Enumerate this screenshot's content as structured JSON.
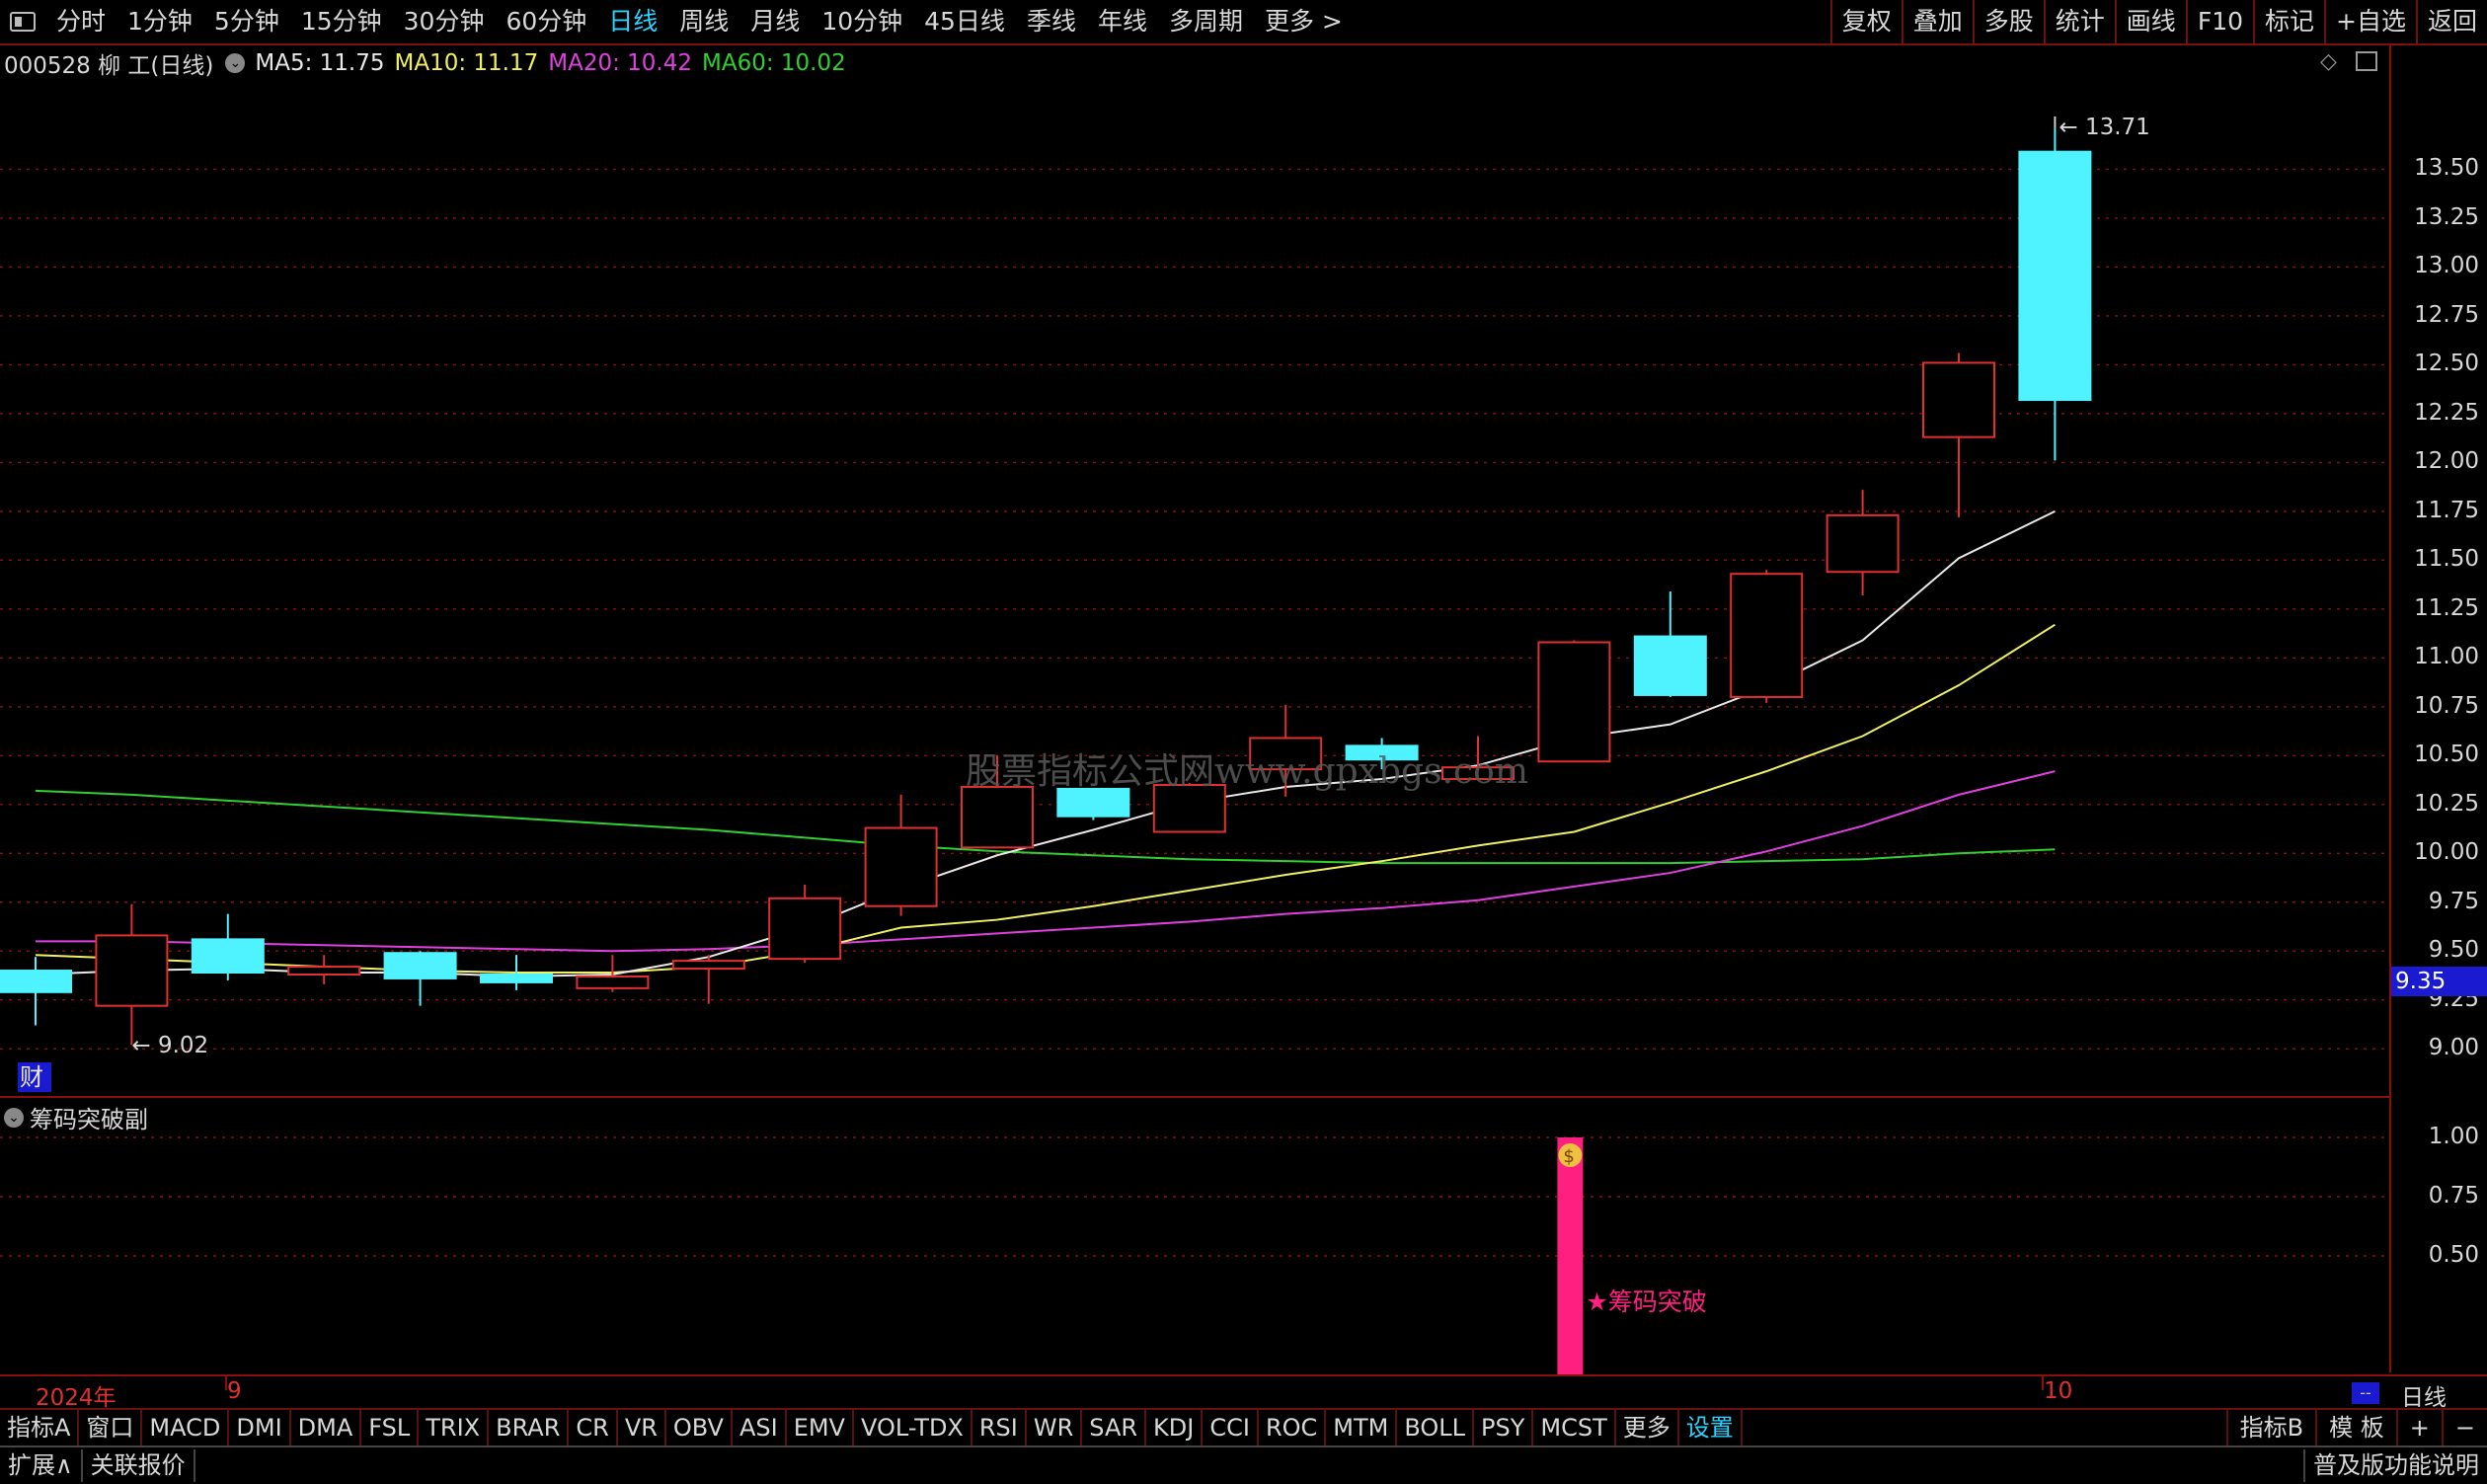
{
  "toolbar": {
    "periods": [
      "分时",
      "1分钟",
      "5分钟",
      "15分钟",
      "30分钟",
      "60分钟",
      "日线",
      "周线",
      "月线",
      "10分钟",
      "45日线",
      "季线",
      "年线",
      "多周期",
      "更多 >"
    ],
    "active_period": "日线",
    "right_buttons": [
      "复权",
      "叠加",
      "多股",
      "统计",
      "画线",
      "F10",
      "标记",
      "+自选",
      "返回"
    ]
  },
  "info": {
    "code_name": "000528 柳 工(日线)",
    "ma5": "MA5: 11.75",
    "ma10": "MA10: 11.17",
    "ma20": "MA20: 10.42",
    "ma60": "MA60: 10.02"
  },
  "colors": {
    "up": "#e03030",
    "down": "#4ff3ff",
    "ma5": "#e8e8e8",
    "ma10": "#f0f060",
    "ma20": "#e040e0",
    "ma60": "#30d030",
    "grid": "#8a1010",
    "signal": "#ff1f80"
  },
  "chart_data": {
    "type": "candlestick",
    "ylim": [
      8.9,
      13.75
    ],
    "yticks": [
      "13.50",
      "13.25",
      "13.00",
      "12.75",
      "12.50",
      "12.25",
      "12.00",
      "11.75",
      "11.50",
      "11.25",
      "11.00",
      "10.75",
      "10.50",
      "10.25",
      "10.00",
      "9.75",
      "9.50",
      "9.25",
      "9.00"
    ],
    "candles": [
      {
        "o": 9.4,
        "h": 9.47,
        "l": 9.12,
        "c": 9.29
      },
      {
        "o": 9.22,
        "h": 9.74,
        "l": 9.02,
        "c": 9.58
      },
      {
        "o": 9.56,
        "h": 9.69,
        "l": 9.35,
        "c": 9.39
      },
      {
        "o": 9.38,
        "h": 9.48,
        "l": 9.33,
        "c": 9.42
      },
      {
        "o": 9.49,
        "h": 9.5,
        "l": 9.22,
        "c": 9.36
      },
      {
        "o": 9.38,
        "h": 9.48,
        "l": 9.3,
        "c": 9.34
      },
      {
        "o": 9.31,
        "h": 9.48,
        "l": 9.29,
        "c": 9.37
      },
      {
        "o": 9.41,
        "h": 9.48,
        "l": 9.23,
        "c": 9.45
      },
      {
        "o": 9.46,
        "h": 9.84,
        "l": 9.44,
        "c": 9.77
      },
      {
        "o": 9.73,
        "h": 10.3,
        "l": 9.68,
        "c": 10.13
      },
      {
        "o": 10.03,
        "h": 10.5,
        "l": 10.03,
        "c": 10.34
      },
      {
        "o": 10.33,
        "h": 10.33,
        "l": 10.17,
        "c": 10.19
      },
      {
        "o": 10.11,
        "h": 10.36,
        "l": 10.11,
        "c": 10.35
      },
      {
        "o": 10.43,
        "h": 10.76,
        "l": 10.29,
        "c": 10.59
      },
      {
        "o": 10.55,
        "h": 10.59,
        "l": 10.43,
        "c": 10.48
      },
      {
        "o": 10.38,
        "h": 10.6,
        "l": 10.38,
        "c": 10.44
      },
      {
        "o": 10.47,
        "h": 11.09,
        "l": 10.47,
        "c": 11.08
      },
      {
        "o": 11.11,
        "h": 11.34,
        "l": 10.8,
        "c": 10.81
      },
      {
        "o": 10.8,
        "h": 11.45,
        "l": 10.77,
        "c": 11.43
      },
      {
        "o": 11.44,
        "h": 11.86,
        "l": 11.32,
        "c": 11.73
      },
      {
        "o": 12.13,
        "h": 12.56,
        "l": 11.72,
        "c": 12.51
      },
      {
        "o": 13.59,
        "h": 13.71,
        "l": 12.01,
        "c": 12.32
      }
    ],
    "ma5": [
      9.38,
      9.4,
      9.41,
      9.39,
      9.39,
      9.37,
      9.38,
      9.47,
      9.62,
      9.82,
      9.99,
      10.12,
      10.26,
      10.34,
      10.38,
      10.45,
      10.59,
      10.66,
      10.85,
      11.09,
      11.51,
      11.75
    ],
    "ma10": [
      9.48,
      9.46,
      9.44,
      9.42,
      9.4,
      9.39,
      9.39,
      9.42,
      9.5,
      9.62,
      9.66,
      9.73,
      9.81,
      9.89,
      9.96,
      10.04,
      10.11,
      10.26,
      10.42,
      10.6,
      10.86,
      11.17
    ],
    "ma20": [
      9.55,
      9.55,
      9.54,
      9.53,
      9.52,
      9.51,
      9.5,
      9.51,
      9.53,
      9.56,
      9.59,
      9.62,
      9.65,
      9.69,
      9.72,
      9.76,
      9.83,
      9.9,
      10.01,
      10.14,
      10.3,
      10.42
    ],
    "ma60": [
      10.32,
      10.3,
      10.27,
      10.24,
      10.21,
      10.18,
      10.15,
      10.12,
      10.08,
      10.04,
      10.01,
      9.99,
      9.97,
      9.96,
      9.95,
      9.95,
      9.95,
      9.95,
      9.96,
      9.97,
      10.0,
      10.02
    ],
    "high_label": "13.71",
    "low_label": "9.02",
    "current_price": "9.35"
  },
  "sub_pane": {
    "title": "筹码突破副",
    "yticks": [
      "1.00",
      "0.75",
      "0.50"
    ],
    "signal_index": 16,
    "signal_label": "★筹码突破"
  },
  "badge_cai": "财",
  "watermark": "股票指标公式网www.gpxbgs.com",
  "dates": {
    "year": "2024年",
    "month9": "9",
    "month10": "10"
  },
  "date_bar_right": "日线",
  "bottom_tabs": [
    "指标A",
    "窗口",
    "MACD",
    "DMI",
    "DMA",
    "FSL",
    "TRIX",
    "BRAR",
    "CR",
    "VR",
    "OBV",
    "ASI",
    "EMV",
    "VOL-TDX",
    "RSI",
    "WR",
    "SAR",
    "KDJ",
    "CCI",
    "ROC",
    "MTM",
    "BOLL",
    "PSY",
    "MCST",
    "更多",
    "设置"
  ],
  "bottom_right": [
    "指标B",
    "模 板",
    "+",
    "−"
  ],
  "status": {
    "expand": "扩展∧",
    "linked": "关联报价",
    "edition": "普及版功能说明"
  }
}
